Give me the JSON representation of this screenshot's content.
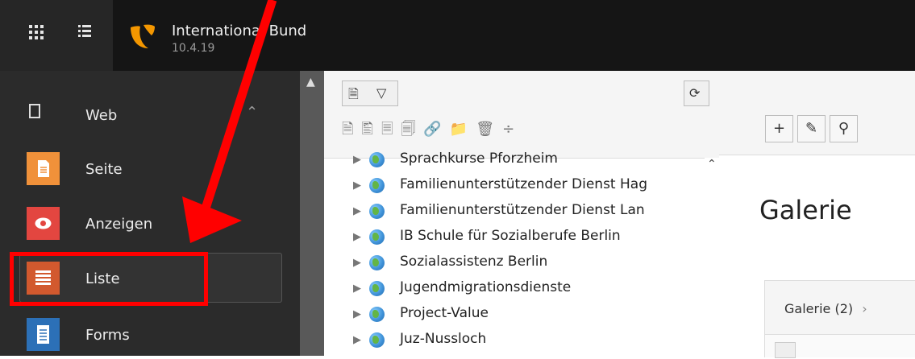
{
  "header": {
    "site_name": "International Bund",
    "version": "10.4.19",
    "apps_icon": "apps-grid-icon",
    "list_icon": "list-icon"
  },
  "sidebar": {
    "group": {
      "label": "Web",
      "icon": "page-icon",
      "chevron": "chevron-up-icon"
    },
    "modules": [
      {
        "label": "Seite",
        "icon": "page-icon",
        "color": "#f0913a"
      },
      {
        "label": "Anzeigen",
        "icon": "eye-icon",
        "color": "#e34640"
      },
      {
        "label": "Liste",
        "icon": "list-icon",
        "color": "#d2592e",
        "active": true
      },
      {
        "label": "Forms",
        "icon": "form-icon",
        "color": "#2c70b7"
      }
    ]
  },
  "tree": {
    "items": [
      "Sprachkurse Pforzheim",
      "Familienunterstützender Dienst Hag",
      "Familienunterstützender Dienst Lan",
      "IB Schule für Sozialberufe Berlin",
      "Sozialassistenz Berlin",
      "Jugendmigrationsdienste",
      "Project-Value",
      "Juz-Nussloch"
    ]
  },
  "content": {
    "title": "Galerie",
    "panel_header": "Galerie (2)",
    "panel_chevron": "›"
  },
  "annotation": {
    "color": "#ff0000"
  }
}
